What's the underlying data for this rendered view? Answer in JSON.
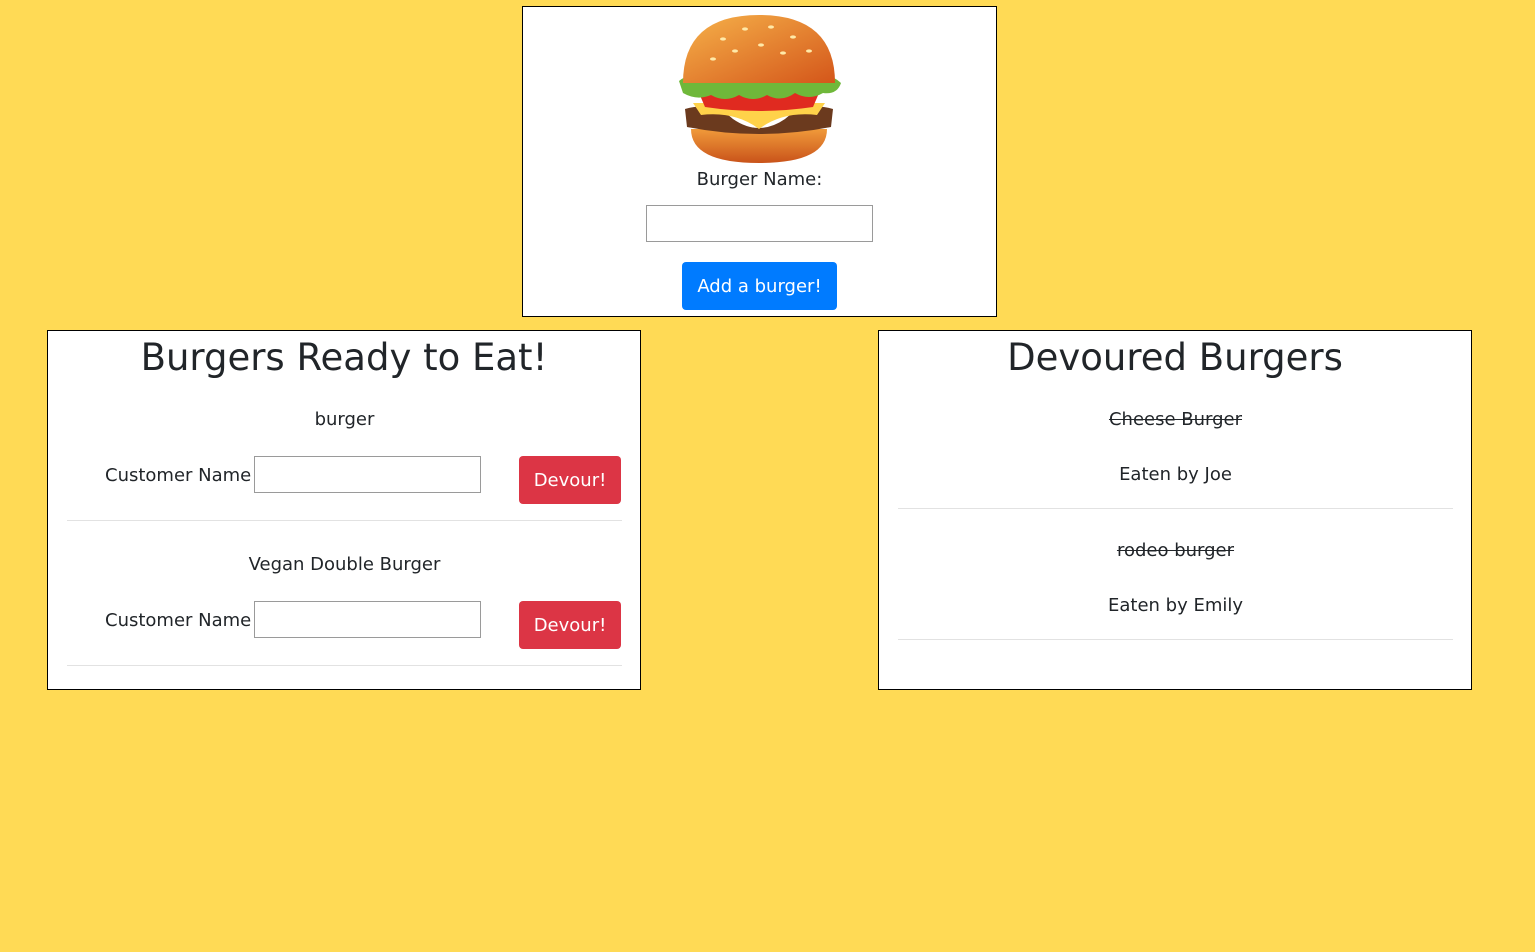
{
  "add_form": {
    "logo_icon": "hamburger-icon",
    "label": "Burger Name:",
    "input_value": "",
    "button_label": "Add a burger!"
  },
  "ready": {
    "title": "Burgers Ready to Eat!",
    "items": [
      {
        "name": "burger",
        "customer_label": "Customer Name",
        "customer_value": "",
        "button_label": "Devour!"
      },
      {
        "name": "Vegan Double Burger",
        "customer_label": "Customer Name",
        "customer_value": "",
        "button_label": "Devour!"
      }
    ]
  },
  "devoured": {
    "title": "Devoured Burgers",
    "items": [
      {
        "name": "Cheese Burger",
        "eaten_by": "Eaten by Joe"
      },
      {
        "name": "rodeo burger",
        "eaten_by": "Eaten by Emily"
      }
    ]
  },
  "colors": {
    "background": "#ffda55",
    "add_button": "#007bff",
    "devour_button": "#dc3545"
  }
}
